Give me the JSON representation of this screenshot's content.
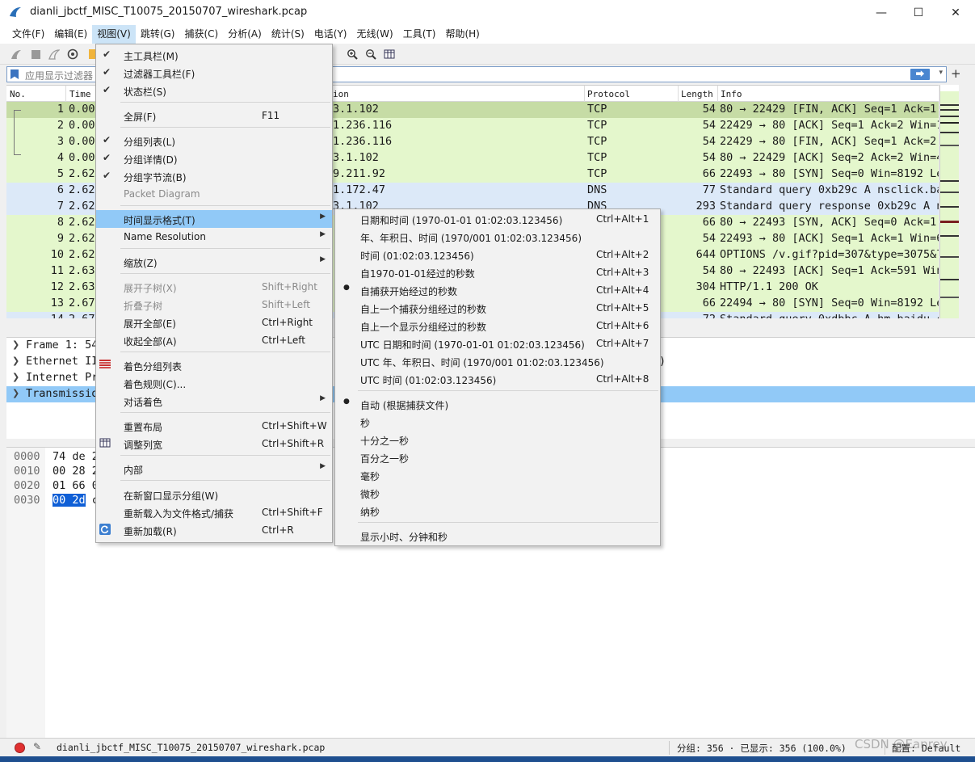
{
  "window": {
    "title": "dianli_jbctf_MISC_T10075_20150707_wireshark.pcap",
    "controls": [
      "—",
      "☐",
      "✕"
    ]
  },
  "menubar": [
    "文件(F)",
    "编辑(E)",
    "视图(V)",
    "跳转(G)",
    "捕获(C)",
    "分析(A)",
    "统计(S)",
    "电话(Y)",
    "无线(W)",
    "工具(T)",
    "帮助(H)"
  ],
  "filter": {
    "placeholder": "应用显示过滤器",
    "apply": "⮕",
    "dropdown": "▾",
    "add": "+"
  },
  "packet_list": {
    "columns": [
      "No.",
      "Time",
      "ion",
      "Protocol",
      "Length",
      "Info"
    ],
    "rows": [
      {
        "no": "1",
        "time": "0.00",
        "dest": "3.1.102",
        "proto": "TCP",
        "len": "54",
        "info": "80 → 22429 [FIN, ACK] Seq=1 Ack=1",
        "bg": "#c6dca5"
      },
      {
        "no": "2",
        "time": "0.00",
        "dest": "1.236.116",
        "proto": "TCP",
        "len": "54",
        "info": "22429 → 80 [ACK] Seq=1 Ack=2 Win=1",
        "bg": "#e4f7cc"
      },
      {
        "no": "3",
        "time": "0.00",
        "dest": "1.236.116",
        "proto": "TCP",
        "len": "54",
        "info": "22429 → 80 [FIN, ACK] Seq=1 Ack=2",
        "bg": "#e4f7cc"
      },
      {
        "no": "4",
        "time": "0.00",
        "dest": "3.1.102",
        "proto": "TCP",
        "len": "54",
        "info": "80 → 22429 [ACK] Seq=2 Ack=2 Win=4",
        "bg": "#e4f7cc"
      },
      {
        "no": "5",
        "time": "2.62",
        "dest": "9.211.92",
        "proto": "TCP",
        "len": "66",
        "info": "22493 → 80 [SYN] Seq=0 Win=8192 Le",
        "bg": "#e4f7cc"
      },
      {
        "no": "6",
        "time": "2.62",
        "dest": "1.172.47",
        "proto": "DNS",
        "len": "77",
        "info": "Standard query 0xb29c A nsclick.ba",
        "bg": "#dce9f8"
      },
      {
        "no": "7",
        "time": "2.62",
        "dest": "3.1.102",
        "proto": "DNS",
        "len": "293",
        "info": "Standard query response 0xb29c A n",
        "bg": "#dce9f8"
      },
      {
        "no": "8",
        "time": "2.62",
        "dest": "",
        "proto": "",
        "len": "66",
        "info": "80 → 22493 [SYN, ACK] Seq=0 Ack=1",
        "bg": "#e4f7cc"
      },
      {
        "no": "9",
        "time": "2.62",
        "dest": "",
        "proto": "",
        "len": "54",
        "info": "22493 → 80 [ACK] Seq=1 Ack=1 Win=6",
        "bg": "#e4f7cc"
      },
      {
        "no": "10",
        "time": "2.62",
        "dest": "",
        "proto": "",
        "len": "644",
        "info": "OPTIONS /v.gif?pid=307&type=3075&l",
        "bg": "#e4f7cc"
      },
      {
        "no": "11",
        "time": "2.63",
        "dest": "",
        "proto": "",
        "len": "54",
        "info": "80 → 22493 [ACK] Seq=1 Ack=591 Win",
        "bg": "#e4f7cc"
      },
      {
        "no": "12",
        "time": "2.63",
        "dest": "",
        "proto": "",
        "len": "304",
        "info": "HTTP/1.1 200 OK",
        "bg": "#e4f7cc"
      },
      {
        "no": "13",
        "time": "2.67",
        "dest": "",
        "proto": "",
        "len": "66",
        "info": "22494 → 80 [SYN] Seq=0 Win=8192 Le",
        "bg": "#e4f7cc"
      },
      {
        "no": "14",
        "time": "2.67",
        "dest": "",
        "proto": "",
        "len": "72",
        "info": "Standard query 0xdbbc A hm.baidu.c",
        "bg": "#dce9f8"
      }
    ]
  },
  "detail": [
    {
      "text": "Frame 1: 54",
      "highlight": false
    },
    {
      "text": "Ethernet II",
      "highlight": false
    },
    {
      "text": "Internet Pr",
      "highlight": false
    },
    {
      "text": "Transmissio",
      "highlight": true
    }
  ],
  "detail_tail": ")",
  "bytes": [
    {
      "off": "0000",
      "hex": "74 de 2"
    },
    {
      "off": "0010",
      "hex": "00 28 2"
    },
    {
      "off": "0020",
      "hex": "01 66 0"
    },
    {
      "off": "0030",
      "hex_sel": "00 2d",
      "hex": " c"
    }
  ],
  "view_menu": {
    "items": [
      {
        "label": "主工具栏(M)",
        "check": true
      },
      {
        "label": "过滤器工具栏(F)",
        "check": true
      },
      {
        "label": "状态栏(S)",
        "check": true
      },
      {
        "label": "全屏(F)",
        "shortcut": "F11"
      },
      {
        "label": "分组列表(L)",
        "check": true
      },
      {
        "label": "分组详情(D)",
        "check": true
      },
      {
        "label": "分组字节流(B)",
        "check": true
      },
      {
        "label": "Packet Diagram",
        "disabled": true
      },
      {
        "label": "时间显示格式(T)",
        "submenu": true,
        "highlighted": true
      },
      {
        "label": "Name Resolution",
        "submenu": true
      },
      {
        "label": "缩放(Z)",
        "submenu": true
      },
      {
        "label": "展开子树(X)",
        "shortcut": "Shift+Right",
        "disabled": true
      },
      {
        "label": "折叠子树",
        "shortcut": "Shift+Left",
        "disabled": true
      },
      {
        "label": "展开全部(E)",
        "shortcut": "Ctrl+Right"
      },
      {
        "label": "收起全部(A)",
        "shortcut": "Ctrl+Left"
      },
      {
        "label": "着色分组列表",
        "icon": "colorize-icon"
      },
      {
        "label": "着色规则(C)..."
      },
      {
        "label": "对话着色",
        "submenu": true
      },
      {
        "label": "重置布局",
        "shortcut": "Ctrl+Shift+W"
      },
      {
        "label": "调整列宽",
        "shortcut": "Ctrl+Shift+R",
        "icon": "resize-columns-icon"
      },
      {
        "label": "内部",
        "submenu": true
      },
      {
        "label": "在新窗口显示分组(W)"
      },
      {
        "label": "重新载入为文件格式/捕获",
        "shortcut": "Ctrl+Shift+F"
      },
      {
        "label": "重新加载(R)",
        "shortcut": "Ctrl+R",
        "icon": "reload-icon"
      }
    ]
  },
  "time_format_submenu": {
    "items": [
      {
        "label": "日期和时间 (1970-01-01 01:02:03.123456)",
        "shortcut": "Ctrl+Alt+1"
      },
      {
        "label": "年、年积日、时间 (1970/001 01:02:03.123456)"
      },
      {
        "label": "时间 (01:02:03.123456)",
        "shortcut": "Ctrl+Alt+2"
      },
      {
        "label": "自1970-01-01经过的秒数",
        "shortcut": "Ctrl+Alt+3"
      },
      {
        "label": "自捕获开始经过的秒数",
        "shortcut": "Ctrl+Alt+4",
        "selected": true
      },
      {
        "label": "自上一个捕获分组经过的秒数",
        "shortcut": "Ctrl+Alt+5"
      },
      {
        "label": "自上一个显示分组经过的秒数",
        "shortcut": "Ctrl+Alt+6"
      },
      {
        "label": "UTC 日期和时间 (1970-01-01 01:02:03.123456)",
        "shortcut": "Ctrl+Alt+7"
      },
      {
        "label": "UTC 年、年积日、时间 (1970/001 01:02:03.123456)"
      },
      {
        "label": "UTC 时间 (01:02:03.123456)",
        "shortcut": "Ctrl+Alt+8"
      },
      {
        "label": "自动 (根据捕获文件)",
        "selected": true
      },
      {
        "label": "秒"
      },
      {
        "label": "十分之一秒"
      },
      {
        "label": "百分之一秒"
      },
      {
        "label": "毫秒"
      },
      {
        "label": "微秒"
      },
      {
        "label": "纳秒"
      },
      {
        "label": "显示小时、分钟和秒"
      }
    ]
  },
  "statusbar": {
    "file": "dianli_jbctf_MISC_T10075_20150707_wireshark.pcap",
    "packets": "分组: 356 · 已显示: 356 (100.0%)",
    "profile": "配置: Default"
  },
  "watermark": "CSDN @Eanrey",
  "colors": {
    "menu_highlight": "#91c9f7",
    "selected_detail": "#91c9f7",
    "tcp_row": "#e4f7cc",
    "dns_row": "#dce9f8",
    "selected_row": "#c6dca5"
  }
}
